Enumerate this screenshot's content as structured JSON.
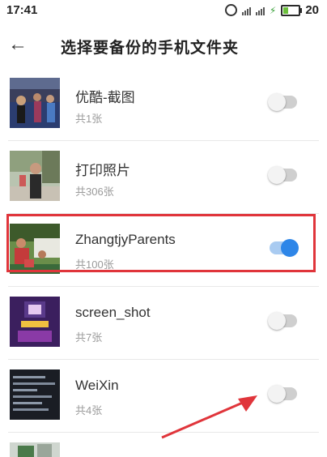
{
  "status_bar": {
    "time": "17:41",
    "battery": "20"
  },
  "header": {
    "back_glyph": "←",
    "title": "选择要备份的手机文件夹"
  },
  "folders": [
    {
      "name": "优酷-截图",
      "count": "共1张",
      "enabled": false
    },
    {
      "name": "打印照片",
      "count": "共306张",
      "enabled": false
    },
    {
      "name": "ZhangtjyParents",
      "count": "共100张",
      "enabled": true
    },
    {
      "name": "screen_shot",
      "count": "共7张",
      "enabled": false
    },
    {
      "name": "WeiXin",
      "count": "共4张",
      "enabled": false
    }
  ],
  "colors": {
    "highlight": "#e0353b",
    "toggle_on": "#2e86e8",
    "arrow": "#e0353b"
  },
  "icons": [
    "back-arrow-icon",
    "alarm-icon",
    "signal-icon",
    "battery-icon"
  ]
}
